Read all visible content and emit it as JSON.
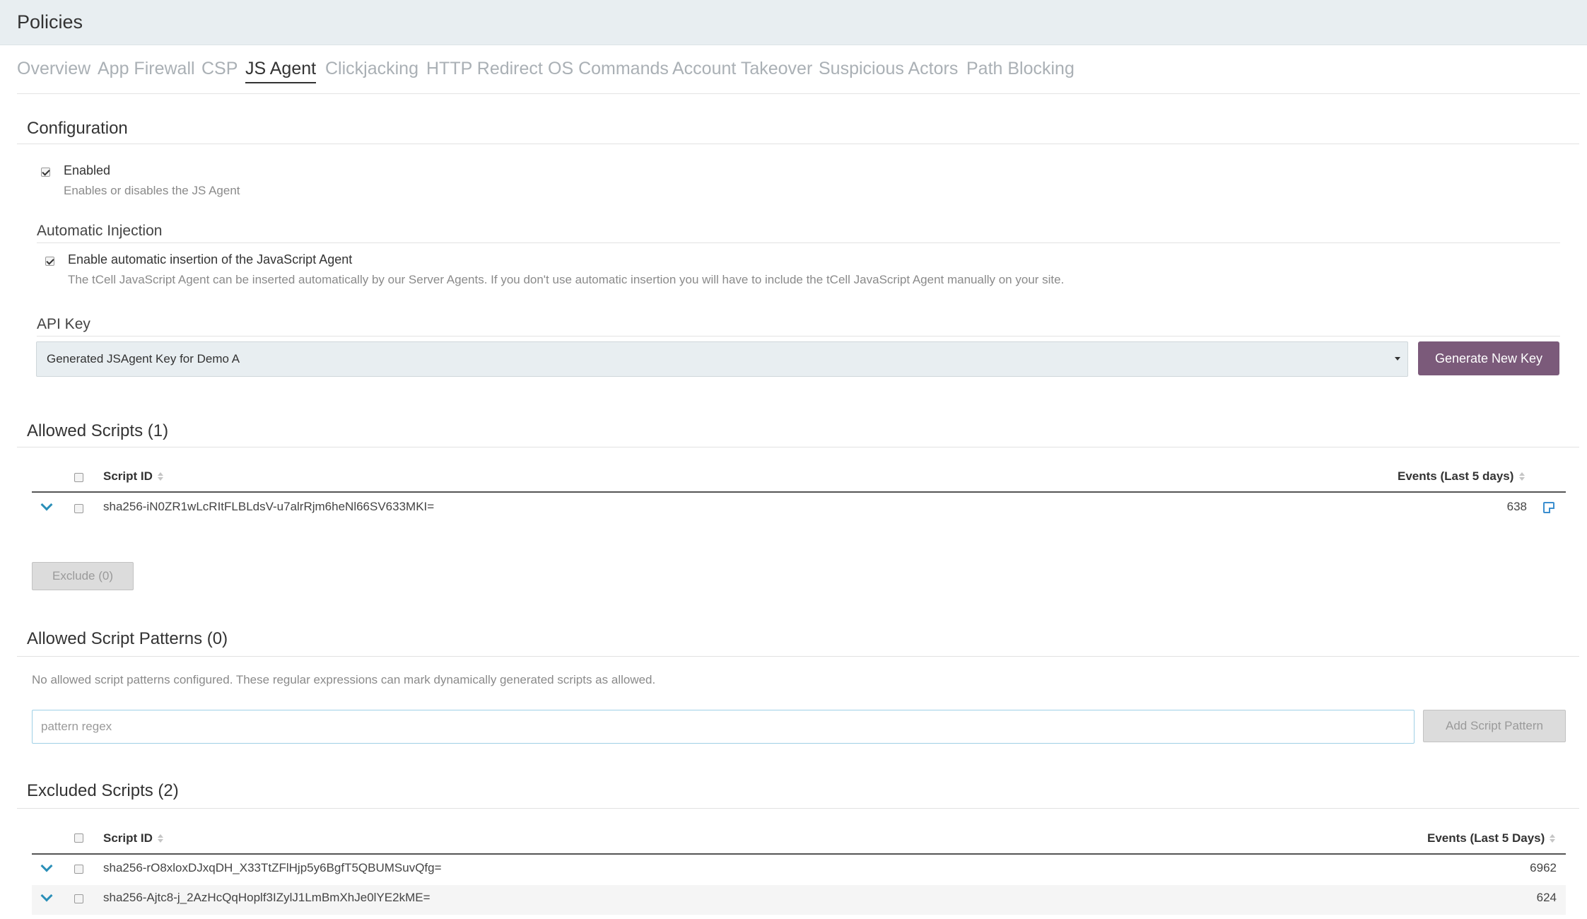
{
  "header": {
    "title": "Policies"
  },
  "tabs": [
    {
      "label": "Overview",
      "active": false
    },
    {
      "label": "App Firewall",
      "active": false
    },
    {
      "label": "CSP",
      "active": false
    },
    {
      "label": "JS Agent",
      "active": true
    },
    {
      "label": "Clickjacking",
      "active": false
    },
    {
      "label": "HTTP Redirect",
      "active": false
    },
    {
      "label": "OS Commands",
      "active": false
    },
    {
      "label": "Account Takeover",
      "active": false
    },
    {
      "label": "Suspicious Actors",
      "active": false
    },
    {
      "label": "Path Blocking",
      "active": false
    }
  ],
  "configuration": {
    "title": "Configuration",
    "enabled": {
      "label": "Enabled",
      "help": "Enables or disables the JS Agent",
      "checked": true
    },
    "automatic_injection": {
      "title": "Automatic Injection",
      "label": "Enable automatic insertion of the JavaScript Agent",
      "help": "The tCell JavaScript Agent can be inserted automatically by our Server Agents. If you don't use automatic insertion you will have to include the tCell JavaScript Agent manually on your site.",
      "checked": true
    },
    "api_key": {
      "title": "API Key",
      "selected": "Generated JSAgent Key for Demo A",
      "generate_button": "Generate New Key"
    }
  },
  "allowed_scripts": {
    "title": "Allowed Scripts (1)",
    "col_script_id": "Script ID",
    "col_events": "Events (Last 5 days)",
    "rows": [
      {
        "script_id": "sha256-iN0ZR1wLcRItFLBLdsV-u7alrRjm6heNl66SV633MKI=",
        "events": "638"
      }
    ],
    "exclude_button": "Exclude (0)"
  },
  "allowed_patterns": {
    "title": "Allowed Script Patterns (0)",
    "empty_text": "No allowed script patterns configured. These regular expressions can mark dynamically generated scripts as allowed.",
    "input_placeholder": "pattern regex",
    "add_button": "Add Script Pattern"
  },
  "excluded_scripts": {
    "title": "Excluded Scripts (2)",
    "col_script_id": "Script ID",
    "col_events": "Events (Last 5 Days)",
    "rows": [
      {
        "script_id": "sha256-rO8xloxDJxqDH_X33TtZFlHjp5y6BgfT5QBUMSuvQfg=",
        "events": "6962"
      },
      {
        "script_id": "sha256-Ajtc8-j_2AzHcQqHoplf3IZylJ1LmBmXhJe0lYE2kME=",
        "events": "624"
      }
    ]
  },
  "colors": {
    "accent_button": "#7b5a7a",
    "header_bg": "#e8eef1",
    "chevron": "#2b8fb8"
  }
}
